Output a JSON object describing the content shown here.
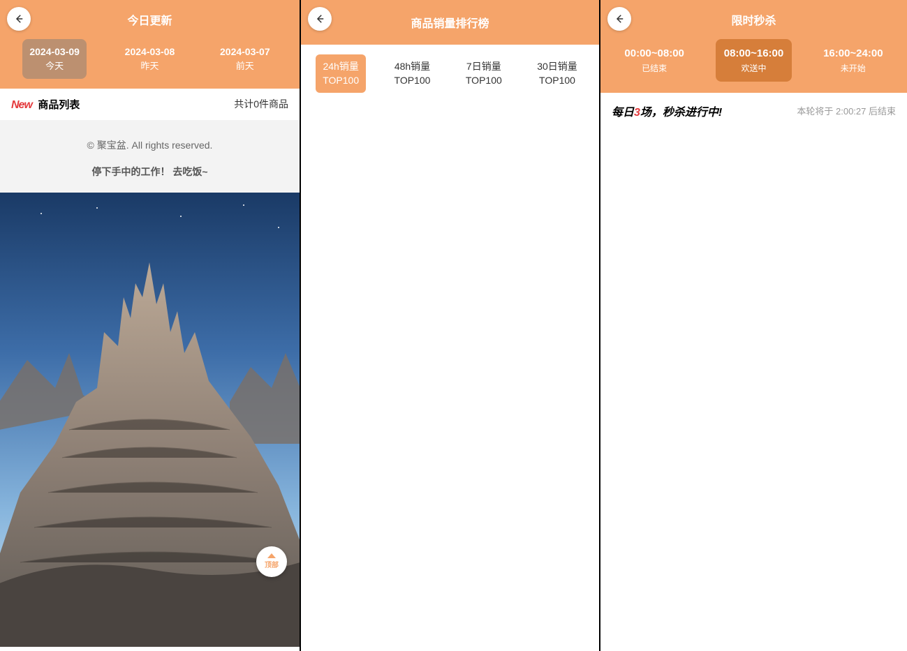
{
  "panel1": {
    "title": "今日更新",
    "tabs": [
      {
        "date": "2024-03-09",
        "sub": "今天"
      },
      {
        "date": "2024-03-08",
        "sub": "昨天"
      },
      {
        "date": "2024-03-07",
        "sub": "前天"
      }
    ],
    "new_badge": "New",
    "list_title": "商品列表",
    "count_text": "共计0件商品",
    "footer_line1": "© 聚宝盆. All rights reserved.",
    "footer_line2": "停下手中的工作！ 去吃饭~",
    "top_label": "顶部"
  },
  "panel2": {
    "title": "商品销量排行榜",
    "tabs": [
      "24h销量\nTOP100",
      "48h销量\nTOP100",
      "7日销量\nTOP100",
      "30日销量\nTOP100"
    ]
  },
  "panel3": {
    "title": "限时秒杀",
    "tabs": [
      {
        "time": "00:00~08:00",
        "state": "已结束"
      },
      {
        "time": "08:00~16:00",
        "state": "欢送中"
      },
      {
        "time": "16:00~24:00",
        "state": "未开始"
      }
    ],
    "badge_parts": [
      "每日",
      "3",
      "场，秒杀进行中!"
    ],
    "info_prefix": "本轮将于 ",
    "info_time": "2:00:27",
    "info_suffix": " 后结束"
  }
}
